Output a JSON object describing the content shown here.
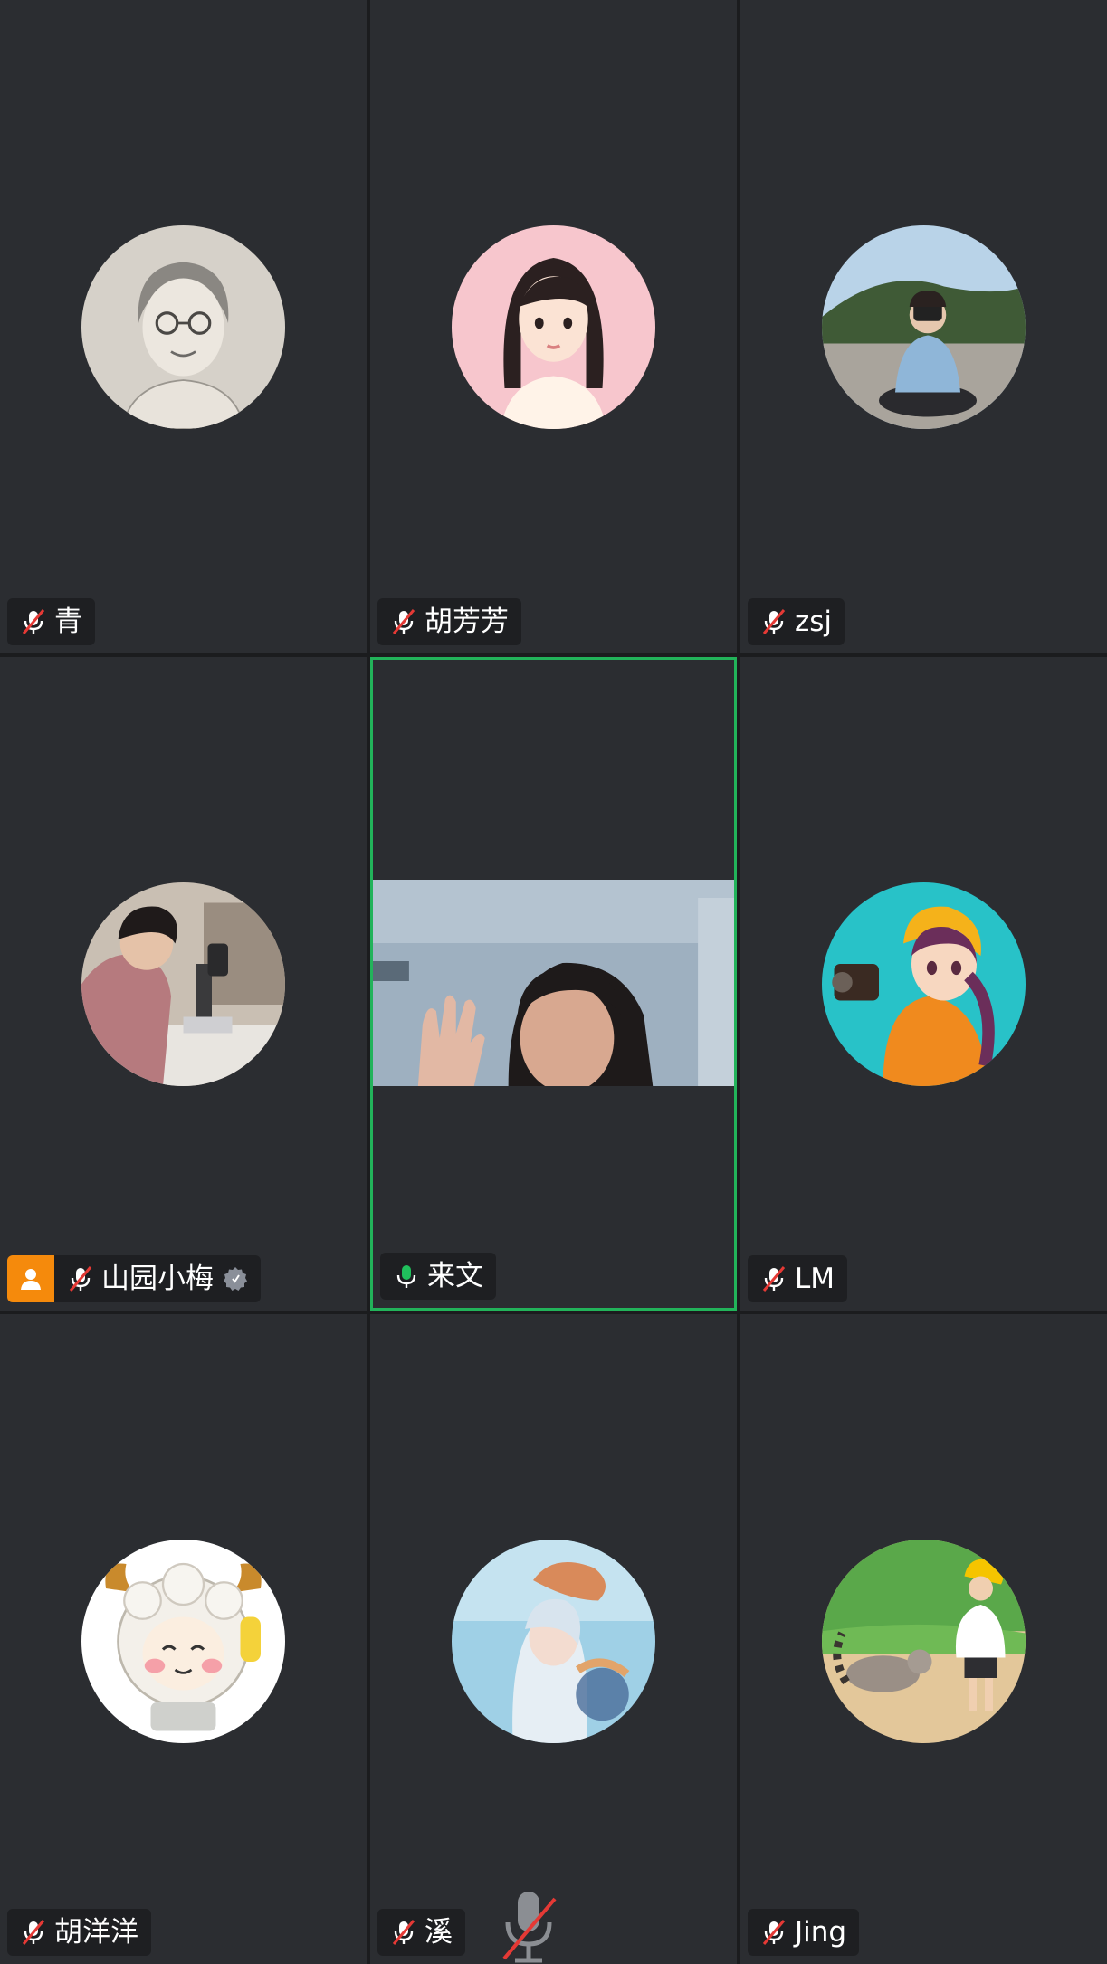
{
  "meeting": {
    "participants": [
      {
        "name": "青",
        "mic": "muted",
        "avatar": "sketch-portrait-avatar"
      },
      {
        "name": "胡芳芳",
        "mic": "muted",
        "avatar": "cartoon-girl-avatar"
      },
      {
        "name": "zsj",
        "mic": "muted",
        "avatar": "photographer-photo-avatar"
      },
      {
        "name": "山园小梅",
        "mic": "muted",
        "avatar": "microscope-photo-avatar",
        "host": true
      },
      {
        "name": "来文",
        "mic": "on",
        "video": "camera-feed",
        "speaking": true
      },
      {
        "name": "LM",
        "mic": "muted",
        "avatar": "anime-girl-camera-avatar"
      },
      {
        "name": "胡洋洋",
        "mic": "muted",
        "avatar": "cartoon-sheep-avatar"
      },
      {
        "name": "溪",
        "mic": "muted",
        "avatar": "watercolor-anime-avatar"
      },
      {
        "name": "Jing",
        "mic": "muted",
        "avatar": "child-with-lemur-avatar"
      }
    ],
    "colors": {
      "tile_bg": "#2b2d31",
      "active_border": "#22b35a",
      "mic_on": "#20c05c",
      "muted_slash": "#e53935",
      "host_badge": "#f58a0c"
    }
  }
}
